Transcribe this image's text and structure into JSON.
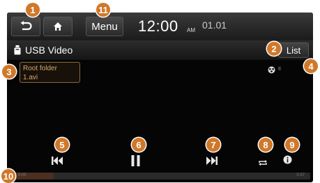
{
  "header": {
    "menu_label": "Menu",
    "time": "12:00",
    "ampm": "AM",
    "date": "01.01"
  },
  "titlebar": {
    "title": "USB Video",
    "list_label": "List"
  },
  "file": {
    "folder": "Root folder",
    "filename": "1.avi"
  },
  "subtitle": {
    "value": "E"
  },
  "playback": {
    "elapsed": "0:05",
    "total": "0:37",
    "progress": 0.135
  },
  "callouts": [
    "1",
    "2",
    "3",
    "4",
    "5",
    "6",
    "7",
    "8",
    "9",
    "10",
    "11"
  ],
  "colors": {
    "accent": "#d0782a",
    "progress_fill": "#4a2f22",
    "folder_text": "#d8a870"
  },
  "icons": [
    "back-icon",
    "home-icon",
    "usb-icon",
    "subtitle-icon",
    "previous-icon",
    "pause-icon",
    "next-icon",
    "repeat-icon",
    "info-icon"
  ]
}
